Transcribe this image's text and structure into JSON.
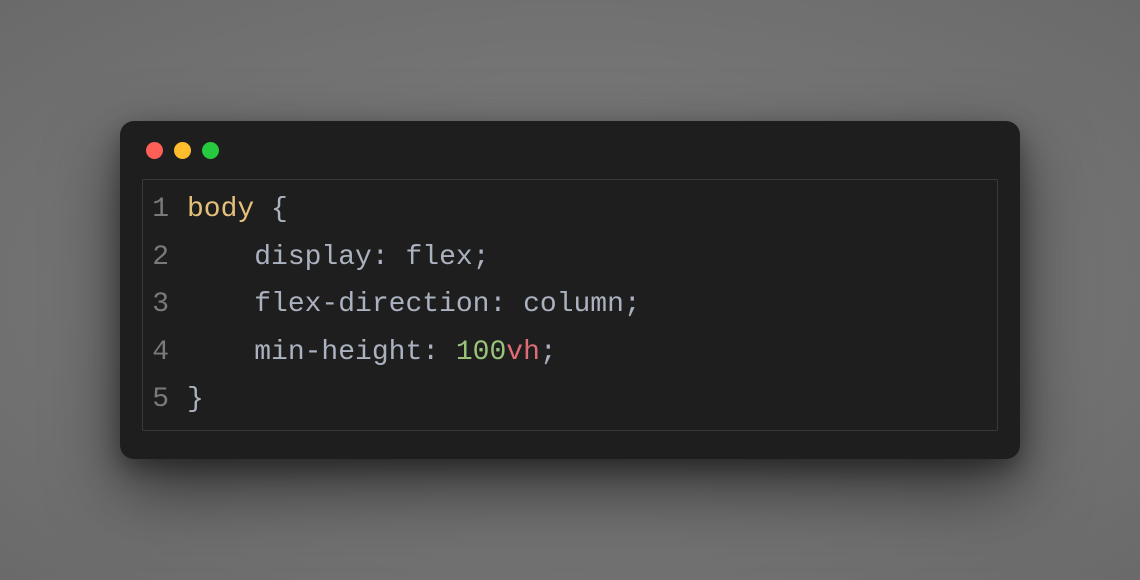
{
  "window": {
    "traffic_lights": [
      "red",
      "yellow",
      "green"
    ]
  },
  "editor": {
    "language": "css",
    "lines": [
      {
        "num": "1",
        "tokens": [
          {
            "cls": "tok-selector",
            "t": "body"
          },
          {
            "cls": "tok-plain",
            "t": " "
          },
          {
            "cls": "tok-punct",
            "t": "{"
          }
        ]
      },
      {
        "num": "2",
        "tokens": [
          {
            "cls": "tok-plain",
            "t": "    "
          },
          {
            "cls": "tok-property",
            "t": "display"
          },
          {
            "cls": "tok-punct",
            "t": ":"
          },
          {
            "cls": "tok-plain",
            "t": " "
          },
          {
            "cls": "tok-value",
            "t": "flex"
          },
          {
            "cls": "tok-punct",
            "t": ";"
          }
        ]
      },
      {
        "num": "3",
        "tokens": [
          {
            "cls": "tok-plain",
            "t": "    "
          },
          {
            "cls": "tok-property",
            "t": "flex-direction"
          },
          {
            "cls": "tok-punct",
            "t": ":"
          },
          {
            "cls": "tok-plain",
            "t": " "
          },
          {
            "cls": "tok-value",
            "t": "column"
          },
          {
            "cls": "tok-punct",
            "t": ";"
          }
        ]
      },
      {
        "num": "4",
        "tokens": [
          {
            "cls": "tok-plain",
            "t": "    "
          },
          {
            "cls": "tok-property",
            "t": "min-height"
          },
          {
            "cls": "tok-punct",
            "t": ":"
          },
          {
            "cls": "tok-plain",
            "t": " "
          },
          {
            "cls": "tok-number",
            "t": "100"
          },
          {
            "cls": "tok-unit",
            "t": "vh"
          },
          {
            "cls": "tok-punct",
            "t": ";"
          }
        ]
      },
      {
        "num": "5",
        "tokens": [
          {
            "cls": "tok-punct",
            "t": "}"
          }
        ]
      }
    ]
  }
}
